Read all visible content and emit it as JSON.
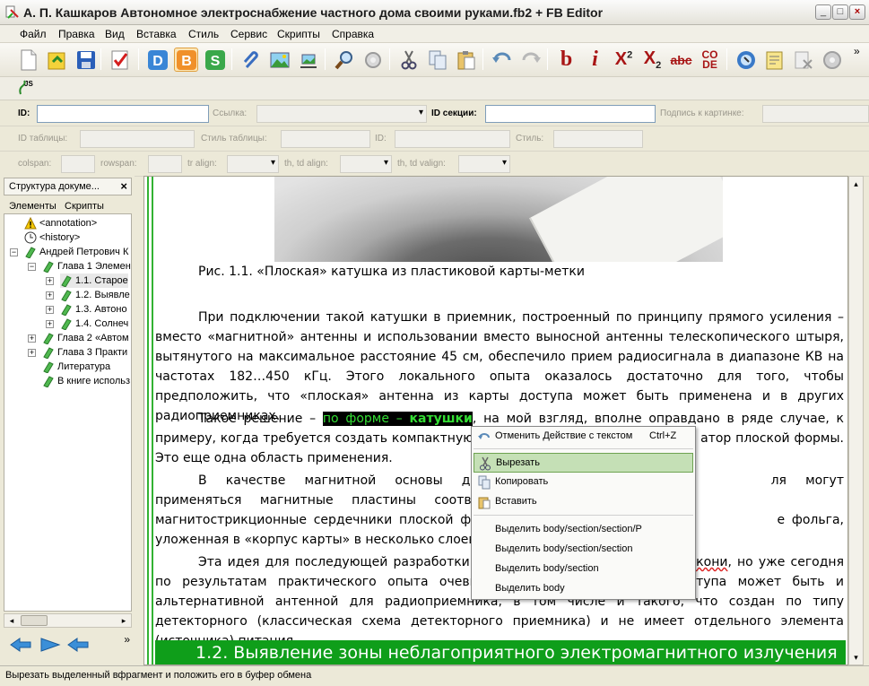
{
  "window": {
    "title": "А. П. Кашкаров Автономное электроснабжение частного дома своими руками.fb2 + FB Editor",
    "btn_minimize": "_",
    "btn_maximize": "□",
    "btn_close": "×"
  },
  "menu": [
    "Файл",
    "Правка",
    "Вид",
    "Вставка",
    "Стиль",
    "Сервис",
    "Скрипты",
    "Справка"
  ],
  "toolbar": {
    "icons": [
      "new-doc-icon",
      "open-icon",
      "save-icon",
      "validate-icon",
      "d-icon",
      "b-icon",
      "s-icon",
      "attach-icon",
      "image-icon",
      "inline-image-icon",
      "find-icon",
      "replace-icon",
      "cut-icon",
      "copy-icon",
      "paste-icon",
      "undo-icon",
      "redo-icon",
      "bold-icon",
      "italic-icon",
      "superscript-icon",
      "subscript-icon",
      "strikethrough-icon",
      "code-icon",
      "link-icon",
      "note-icon",
      "clear-icon",
      "settings-icon"
    ],
    "label_d": "D",
    "label_b": "B",
    "label_s": "S",
    "label_bold": "b",
    "label_italic": "i",
    "label_x": "X",
    "label_sup": "2",
    "label_sub": "2",
    "label_abc": "abc",
    "label_code_top": "CO",
    "label_code_bottom": "DE",
    "overflow": "»"
  },
  "toolbar2": {
    "script_label": "JS"
  },
  "props_row1": {
    "id_label": "ID:",
    "link_label": "Ссылка:",
    "section_id_label": "ID секции:",
    "caption_label": "Подпись к картинке:"
  },
  "props_row2": {
    "table_id_label": "ID таблицы:",
    "table_style_label": "Стиль таблицы:",
    "id_label": "ID:",
    "style_label": "Стиль:"
  },
  "props_row3": {
    "colspan_label": "colspan:",
    "rowspan_label": "rowspan:",
    "tr_align_label": "tr align:",
    "th_td_align_label": "th, td align:",
    "th_td_valign_label": "th, td valign:"
  },
  "leftpanel": {
    "title": "Структура докуме...",
    "close": "×",
    "tab_elements": "Элементы",
    "tab_scripts": "Скрипты",
    "tree": [
      {
        "label": "<annotation>",
        "icon": "warning-icon",
        "expander": ""
      },
      {
        "label": "<history>",
        "icon": "clock-icon",
        "expander": ""
      },
      {
        "label": "Андрей Петрович К",
        "icon": "section-icon",
        "expander": "−"
      },
      {
        "label": "Глава 1 Элемен",
        "icon": "section-icon",
        "expander": "−"
      },
      {
        "label": "1.1. Старое",
        "icon": "section-icon",
        "expander": "+"
      },
      {
        "label": "1.2. Выявле",
        "icon": "section-icon",
        "expander": "+"
      },
      {
        "label": "1.3. Автоно",
        "icon": "section-icon",
        "expander": "+"
      },
      {
        "label": "1.4. Солнеч",
        "icon": "section-icon",
        "expander": "+"
      },
      {
        "label": "Глава 2 «Автом",
        "icon": "section-icon",
        "expander": "+"
      },
      {
        "label": "Глава 3 Практи",
        "icon": "section-icon",
        "expander": "+"
      },
      {
        "label": "Литература",
        "icon": "section-icon",
        "expander": ""
      },
      {
        "label": "В книге использ",
        "icon": "section-icon",
        "expander": ""
      }
    ],
    "scroll_left": "◂",
    "scroll_right": "▸",
    "nav_more": "»"
  },
  "editor": {
    "caption": "Рис. 1.1. «Плоская» катушка из пластиковой карты-метки",
    "p1": "При подключении такой катушки в приемник, построенный по принципу прямого усиления – вместо «магнитной» антенны и использовании вместо выносной антенны телескопического штыря, вытянутого на максимальное расстояние 45 см, обеспечило прием радиосигнала в диапазоне КВ на частотах 182…450 кГц. Этого локального опыта оказалось достаточно для того, чтобы предположить, что «плоская» антенна из карты доступа может быть применена и в других радиоприемниках.",
    "p2_start": "Такое решение – ",
    "p2_sel_plain": "по форме – ",
    "p2_sel_bold": "катушки",
    "p2_mid": ", на мой взгляд, вполне оправдано в ряде случае, к примеру, когда требуется создать компактную",
    "p2_hidden_gap": "                                                   ",
    "p2_end": "атор плоской формы. Это еще одна область применения.",
    "p3_a": "В качестве магнитной основы для подоб",
    "p3_b": "ля могут применяться магнитные пластины соответствующей формы",
    "p3_c": "магнитострикционные сердечники плоской формы, или, в подходящи",
    "p3_d": "е фольга, уложенная в «корпус карты» в несколько слоев.",
    "p4_a": "Эта идея для последующей разработки с",
    "p4_squig": "окони",
    "p4_b": ", но уже сегодня по результатам практического опыта очевидно",
    "p4_c": "доступа может быть и альтернативной антенной для радиоприемника, в том числе и такого, что создан по типу детекторного (классическая схема детекторного приемника) и не имеет отдельного элемента (источника) питания.",
    "heading": "1.2. Выявление зоны неблагоприятного электромагнитного излучения"
  },
  "context_menu": {
    "undo": "Отменить Действие с текстом",
    "undo_shortcut": "Ctrl+Z",
    "cut": "Вырезать",
    "copy": "Копировать",
    "paste": "Вставить",
    "sel1": "Выделить body/section/section/P",
    "sel2": "Выделить body/section/section",
    "sel3": "Выделить body/section",
    "sel4": "Выделить body"
  },
  "vscroll": {
    "up": "▴",
    "down": "▾"
  },
  "status": "Вырезать выделенный вфрагмент и положить его в буфер обмена",
  "colors": {
    "selection_bg": "#000000",
    "selection_fg": "#33dd33",
    "heading_bg": "#0f9e1a",
    "menu_highlight": "#c5e0b6"
  }
}
